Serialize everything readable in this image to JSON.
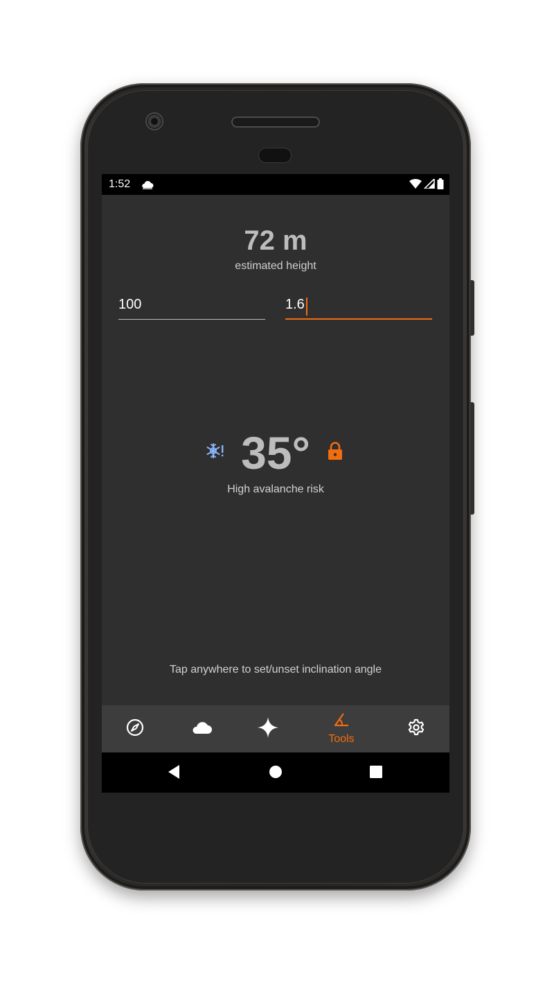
{
  "status_bar": {
    "time": "1:52",
    "icons": [
      "cloud-icon",
      "wifi-icon",
      "signal-icon",
      "battery-icon"
    ]
  },
  "inclinometer": {
    "estimated_height_value": "72 m",
    "estimated_height_label": "estimated height",
    "distance_input": {
      "value": "100"
    },
    "eye_height_input": {
      "value": "1.6"
    },
    "angle_value": "35°",
    "risk_label": "High avalanche risk",
    "risk_icon": "avalanche-warning-icon",
    "lock_icon": "lock-icon",
    "hint": "Tap anywhere to set/unset inclination angle"
  },
  "bottom_nav": {
    "items": [
      {
        "icon": "compass-icon",
        "label": ""
      },
      {
        "icon": "cloud-icon",
        "label": ""
      },
      {
        "icon": "astronomy-star-icon",
        "label": ""
      },
      {
        "icon": "tools-angle-icon",
        "label": "Tools",
        "selected": true
      },
      {
        "icon": "gear-icon",
        "label": ""
      }
    ]
  },
  "system_nav": {
    "icons": [
      "back-icon",
      "home-icon",
      "recents-icon"
    ]
  },
  "colors": {
    "accent": "#f26d0f",
    "background": "#2f2f2f",
    "nav_background": "#3d3d3d",
    "avalanche_icon": "#8ab4f8"
  }
}
